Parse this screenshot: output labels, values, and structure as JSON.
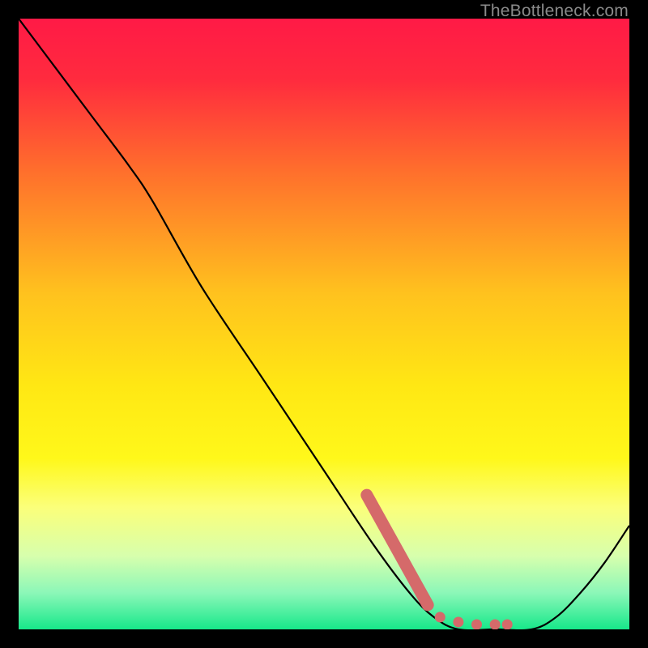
{
  "watermark": "TheBottleneck.com",
  "chart_data": {
    "type": "line",
    "title": "",
    "xlabel": "",
    "ylabel": "",
    "xlim": [
      0,
      100
    ],
    "ylim": [
      0,
      100
    ],
    "background_gradient": {
      "stops": [
        {
          "offset": 0.0,
          "color": "#ff1a46"
        },
        {
          "offset": 0.1,
          "color": "#ff2b3e"
        },
        {
          "offset": 0.25,
          "color": "#ff6f2c"
        },
        {
          "offset": 0.45,
          "color": "#ffc21e"
        },
        {
          "offset": 0.6,
          "color": "#ffe714"
        },
        {
          "offset": 0.72,
          "color": "#fff81a"
        },
        {
          "offset": 0.8,
          "color": "#fbff7a"
        },
        {
          "offset": 0.88,
          "color": "#d7ffad"
        },
        {
          "offset": 0.94,
          "color": "#8cf7b8"
        },
        {
          "offset": 1.0,
          "color": "#17e88a"
        }
      ]
    },
    "series": [
      {
        "name": "curve",
        "color": "#000000",
        "x": [
          0,
          6,
          12,
          18,
          22,
          30,
          40,
          50,
          58,
          64,
          68,
          72,
          78,
          84,
          88,
          92,
          96,
          100
        ],
        "y": [
          100,
          92,
          84,
          76,
          70,
          56,
          41,
          26,
          14,
          6,
          2,
          0,
          0,
          0,
          2,
          6,
          11,
          17
        ]
      }
    ],
    "highlight": {
      "name": "highlight-segment",
      "color": "#d56a6a",
      "x": [
        57,
        67
      ],
      "y": [
        22,
        4
      ],
      "dots_x": [
        69,
        72,
        75,
        78,
        80
      ],
      "dots_y": [
        2,
        1.2,
        0.8,
        0.8,
        0.8
      ]
    }
  }
}
